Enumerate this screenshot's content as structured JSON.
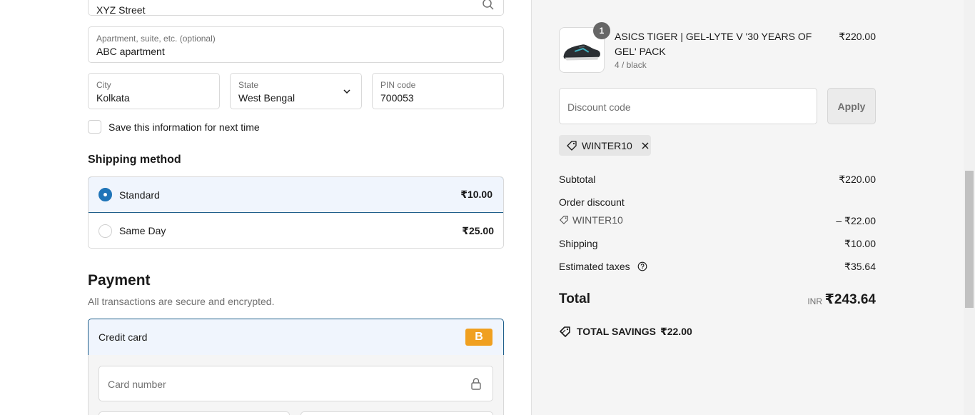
{
  "address": {
    "value": "XYZ Street"
  },
  "apartment": {
    "label": "Apartment, suite, etc. (optional)",
    "value": "ABC apartment"
  },
  "city": {
    "label": "City",
    "value": "Kolkata"
  },
  "state": {
    "label": "State",
    "value": "West Bengal"
  },
  "pin": {
    "label": "PIN code",
    "value": "700053"
  },
  "save_info": {
    "label": "Save this information for next time",
    "checked": false
  },
  "shipping": {
    "heading": "Shipping method",
    "options": [
      {
        "name": "Standard",
        "price": "₹10.00",
        "selected": true
      },
      {
        "name": "Same Day",
        "price": "₹25.00",
        "selected": false
      }
    ]
  },
  "payment": {
    "heading": "Payment",
    "subtitle": "All transactions are secure and encrypted.",
    "method_label": "Credit card",
    "method_badge": "B",
    "card_number_placeholder": "Card number"
  },
  "cart": {
    "item": {
      "quantity": "1",
      "name": "ASICS TIGER | GEL-LYTE V '30 YEARS OF GEL' PACK",
      "variant": "4 / black",
      "price": "₹220.00"
    },
    "discount_placeholder": "Discount code",
    "apply_label": "Apply",
    "applied_code": "WINTER10",
    "summary": {
      "subtotal_label": "Subtotal",
      "subtotal_value": "₹220.00",
      "order_discount_label": "Order discount",
      "discount_code": "WINTER10",
      "discount_value": "– ₹22.00",
      "shipping_label": "Shipping",
      "shipping_value": "₹10.00",
      "taxes_label": "Estimated taxes",
      "taxes_value": "₹35.64",
      "total_label": "Total",
      "currency": "INR",
      "total_value": "₹243.64",
      "savings_label": "TOTAL SAVINGS",
      "savings_value": "₹22.00"
    }
  },
  "colors": {
    "accent": "#1f74b8",
    "selected_bg": "#f0f5fd",
    "badge": "#f0a020"
  },
  "icons": [
    "search-icon",
    "chevron-down-icon",
    "lock-icon",
    "tag-icon",
    "close-icon",
    "help-icon",
    "savings-tag-icon"
  ]
}
